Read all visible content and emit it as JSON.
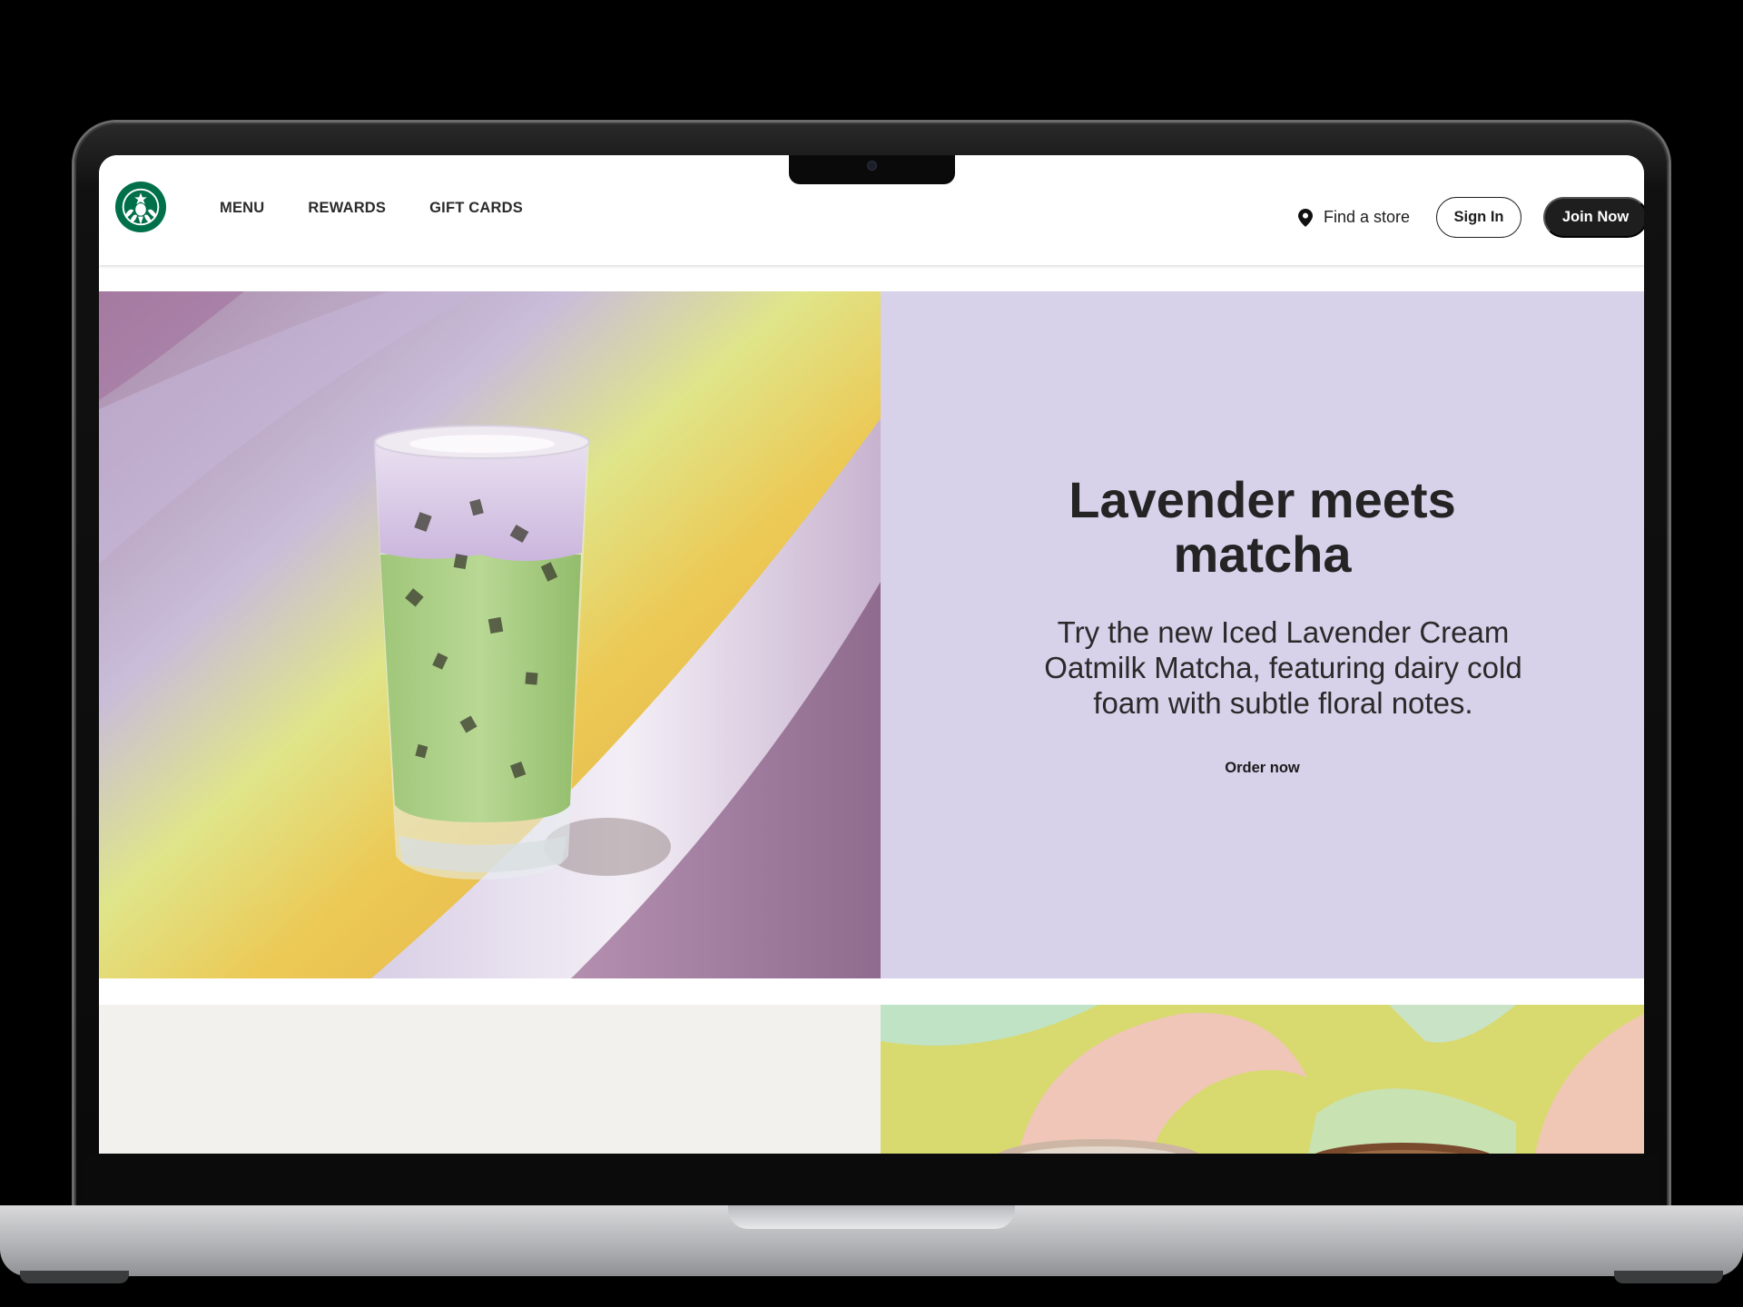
{
  "header": {
    "nav": [
      {
        "label": "MENU"
      },
      {
        "label": "REWARDS"
      },
      {
        "label": "GIFT CARDS"
      }
    ],
    "find_store": "Find a store",
    "sign_in": "Sign In",
    "join_now": "Join Now"
  },
  "hero": {
    "title_line1": "Lavender meets",
    "title_line2": "matcha",
    "description": "Try the new Iced Lavender Cream Oatmilk Matcha, featuring dairy cold foam with subtle floral notes.",
    "cta": "Order now",
    "panel_color": "#d7d1ea"
  },
  "colors": {
    "brand_green": "#00704a",
    "dark_button": "#1e1e1e"
  }
}
